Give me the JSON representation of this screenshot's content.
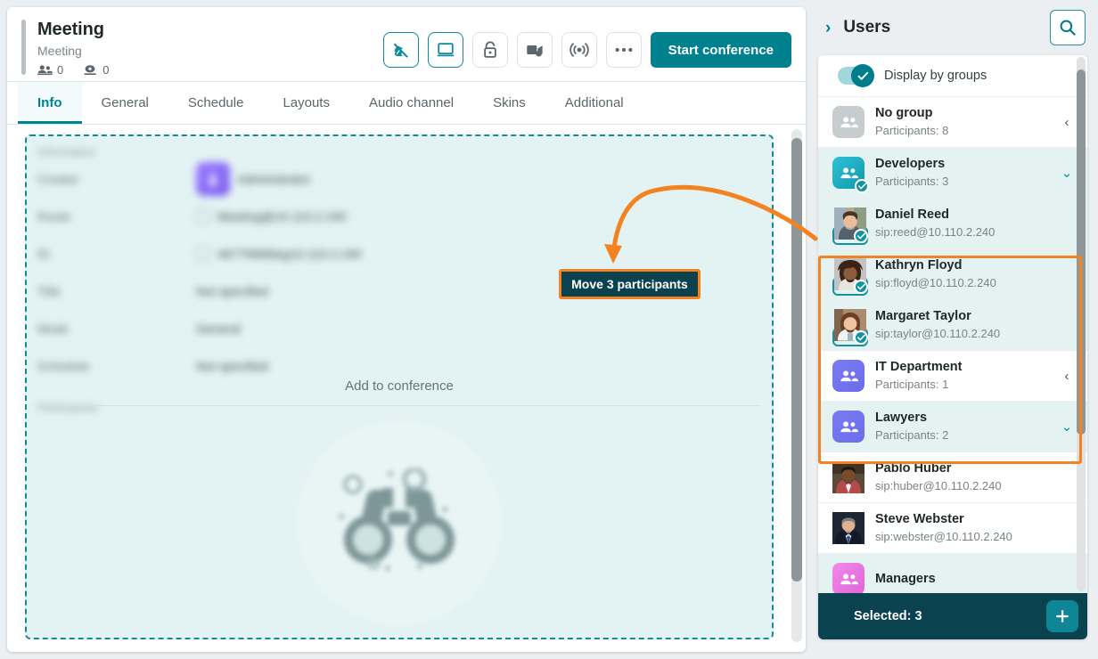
{
  "meeting": {
    "title": "Meeting",
    "subtitle": "Meeting",
    "participants_count": "0",
    "viewers_count": "0",
    "start_button": "Start conference",
    "toolbar_icons": [
      {
        "name": "microphone-off-icon",
        "active": true
      },
      {
        "name": "screen-share-icon",
        "active": true
      },
      {
        "name": "lock-icon",
        "active": false
      },
      {
        "name": "video-camera-icon",
        "active": false
      },
      {
        "name": "broadcast-icon",
        "active": false
      },
      {
        "name": "more-options-icon",
        "active": false
      }
    ]
  },
  "tabs": [
    {
      "label": "Info",
      "active": true
    },
    {
      "label": "General",
      "active": false
    },
    {
      "label": "Schedule",
      "active": false
    },
    {
      "label": "Layouts",
      "active": false
    },
    {
      "label": "Audio channel",
      "active": false
    },
    {
      "label": "Skins",
      "active": false
    },
    {
      "label": "Additional",
      "active": false
    }
  ],
  "info": {
    "section_label": "Information",
    "rows": [
      {
        "label": "Creator",
        "value": "Administrator"
      },
      {
        "label": "Route",
        "value": "Meeting@10.110.2.240"
      },
      {
        "label": "ID",
        "value": "4677066fdsg10.110.2.240"
      },
      {
        "label": "Title",
        "value": "Not specified"
      },
      {
        "label": "Mode",
        "value": "General"
      },
      {
        "label": "Schedule",
        "value": "Not specified"
      }
    ],
    "participants_label": "Participants",
    "add_to_conference": "Add to conference",
    "empty_icon": "binoculars-icon"
  },
  "callout": {
    "label": "Move 3 participants",
    "border_color": "#f58220",
    "background": "#0b4250"
  },
  "users_panel": {
    "title": "Users",
    "collapse_icon": "chevron-right-icon",
    "search_icon": "search-icon",
    "display_by_groups_label": "Display by groups",
    "display_by_groups_on": true,
    "selected_label": "Selected: 3",
    "add_button_icon": "plus-icon",
    "rows": [
      {
        "kind": "group",
        "name": "No group",
        "sub": "Participants: 8",
        "icon_color": "gray",
        "expanded": false,
        "selected": false,
        "checked": false
      },
      {
        "kind": "group",
        "name": "Developers",
        "sub": "Participants: 3",
        "icon_color": "teal",
        "expanded": true,
        "selected": true,
        "checked": true
      },
      {
        "kind": "user",
        "name": "Daniel Reed",
        "sub": "sip:reed@10.110.2.240",
        "selected": true,
        "checked": true,
        "avatar": "photo-male-1"
      },
      {
        "kind": "user",
        "name": "Kathryn Floyd",
        "sub": "sip:floyd@10.110.2.240",
        "selected": true,
        "checked": true,
        "avatar": "photo-female-1"
      },
      {
        "kind": "user",
        "name": "Margaret Taylor",
        "sub": "sip:taylor@10.110.2.240",
        "selected": true,
        "checked": true,
        "avatar": "photo-female-2"
      },
      {
        "kind": "group",
        "name": "IT Department",
        "sub": "Participants: 1",
        "icon_color": "blue",
        "expanded": false,
        "selected": false,
        "checked": false
      },
      {
        "kind": "group",
        "name": "Lawyers",
        "sub": "Participants: 2",
        "icon_color": "blue",
        "expanded": true,
        "selected": true,
        "checked": false
      },
      {
        "kind": "user",
        "name": "Pablo Huber",
        "sub": "sip:huber@10.110.2.240",
        "selected": false,
        "checked": false,
        "avatar": "photo-male-2"
      },
      {
        "kind": "user",
        "name": "Steve Webster",
        "sub": "sip:webster@10.110.2.240",
        "selected": false,
        "checked": false,
        "avatar": "photo-male-3"
      },
      {
        "kind": "group",
        "name": "Managers",
        "sub": "",
        "icon_color": "pink",
        "expanded": false,
        "selected": true,
        "checked": false
      }
    ]
  }
}
